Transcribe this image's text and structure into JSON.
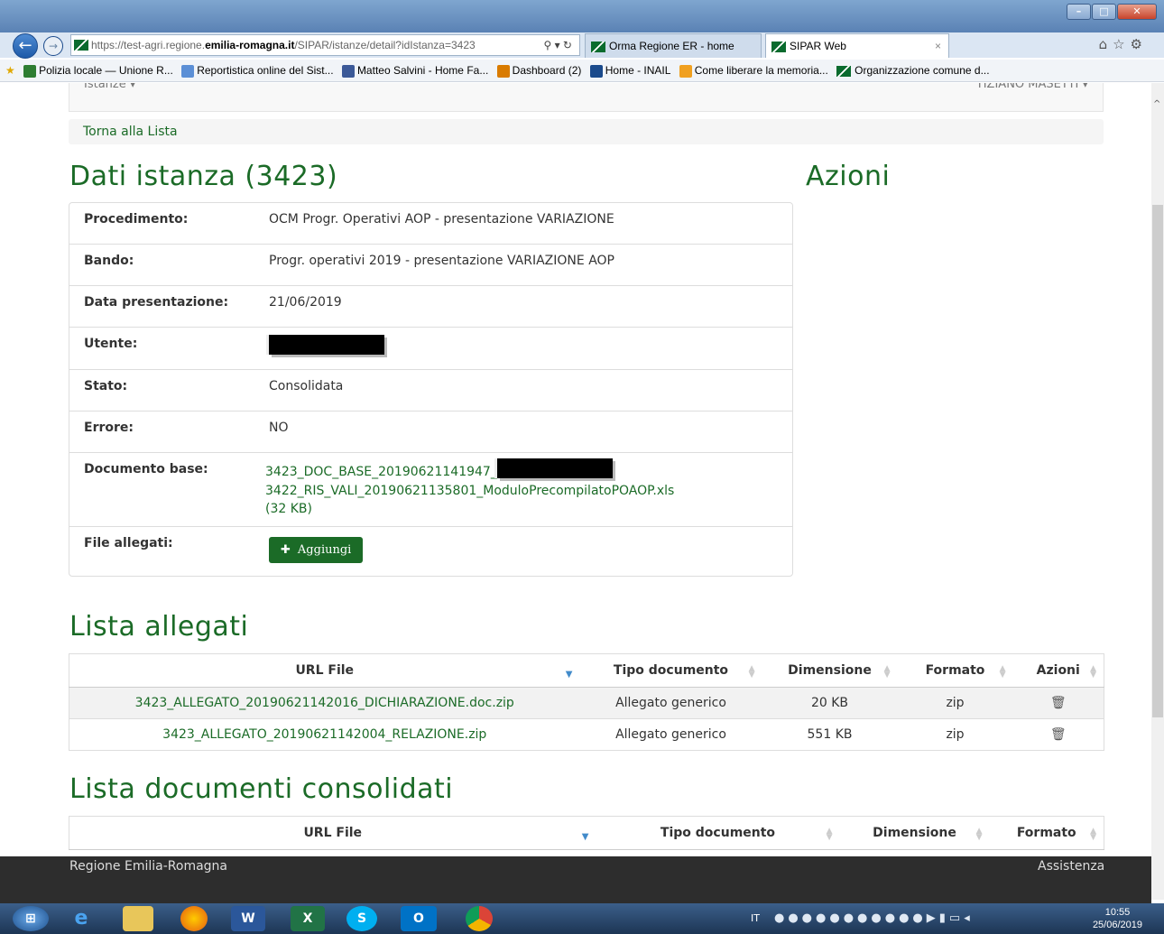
{
  "browser": {
    "url_prefix": "https://test-agri.regione.",
    "url_domain": "emilia-romagna.it",
    "url_path": "/SIPAR/istanze/detail?idIstanza=3423",
    "tabs": [
      {
        "label": "Orma Regione ER - home"
      },
      {
        "label": "SIPAR Web"
      }
    ],
    "favorites": [
      "Polizia locale — Unione R...",
      "Reportistica online del Sist...",
      "Matteo Salvini - Home Fa...",
      "Dashboard (2)",
      "Home - INAIL",
      "Come liberare la memoria...",
      "Organizzazione comune d..."
    ]
  },
  "topnav": {
    "menu": "Istanze ▾",
    "user": "TIZIANO MASETTI ▾"
  },
  "back_link": "Torna alla Lista",
  "detail": {
    "title": "Dati istanza (3423)",
    "rows": [
      {
        "label": "Procedimento:",
        "value": "OCM Progr. Operativi AOP - presentazione VARIAZIONE"
      },
      {
        "label": "Bando:",
        "value": "Progr. operativi 2019 - presentazione VARIAZIONE AOP"
      },
      {
        "label": "Data presentazione:",
        "value": "21/06/2019"
      },
      {
        "label": "Utente:",
        "value": ""
      },
      {
        "label": "Stato:",
        "value": "Consolidata"
      },
      {
        "label": "Errore:",
        "value": "NO"
      }
    ],
    "doc_label": "Documento base:",
    "doc_line1": "3423_DOC_BASE_20190621141947_",
    "doc_line2": "3422_RIS_VALI_20190621135801_ModuloPrecompilatoPOAOP.xls",
    "doc_size": "(32 KB)",
    "files_label": "File allegati:",
    "add_button": "Aggiungi"
  },
  "actions_title": "Azioni",
  "allegati": {
    "title": "Lista allegati",
    "headers": [
      "URL File",
      "Tipo documento",
      "Dimensione",
      "Formato",
      "Azioni"
    ],
    "rows": [
      {
        "file": "3423_ALLEGATO_20190621142016_DICHIARAZIONE.doc.zip",
        "tipo": "Allegato generico",
        "dim": "20 KB",
        "formato": "zip"
      },
      {
        "file": "3423_ALLEGATO_20190621142004_RELAZIONE.zip",
        "tipo": "Allegato generico",
        "dim": "551 KB",
        "formato": "zip"
      }
    ]
  },
  "consolidati": {
    "title": "Lista documenti consolidati",
    "headers": [
      "URL File",
      "Tipo documento",
      "Dimensione",
      "Formato"
    ]
  },
  "footer": {
    "left": "Regione Emilia-Romagna",
    "right": "Assistenza"
  },
  "taskbar": {
    "lang": "IT",
    "time": "10:55",
    "date": "25/06/2019"
  }
}
